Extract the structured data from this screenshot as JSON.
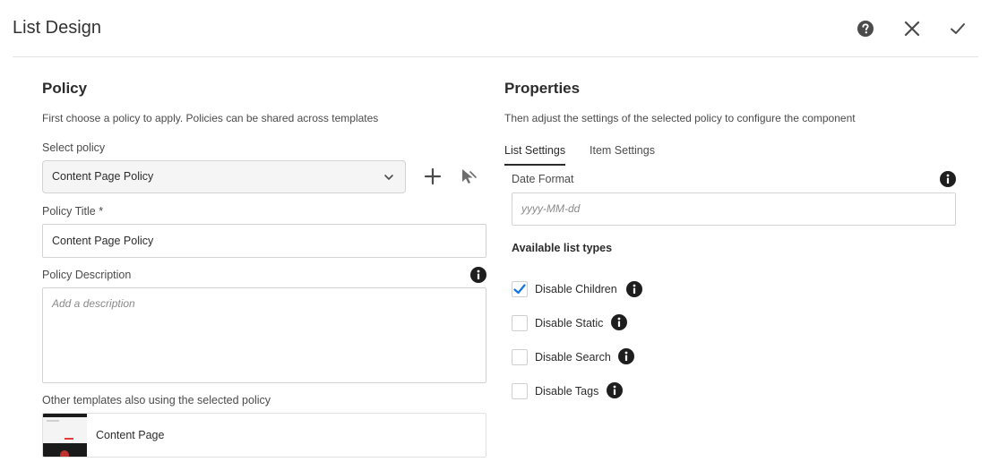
{
  "header": {
    "title": "List Design",
    "help_icon": "help-circle-icon",
    "close_icon": "close-icon",
    "done_icon": "checkmark-icon"
  },
  "policy": {
    "title": "Policy",
    "description": "First choose a policy to apply. Policies can be shared across templates",
    "select_label": "Select policy",
    "selected_policy": "Content Page Policy",
    "add_icon": "add-icon",
    "select_icon": "select-cursor-icon",
    "title_label": "Policy Title *",
    "title_value": "Content Page Policy",
    "description_label": "Policy Description",
    "description_placeholder": "Add a description",
    "other_templates_label": "Other templates also using the selected policy",
    "templates": [
      {
        "name": "Content Page"
      }
    ]
  },
  "properties": {
    "title": "Properties",
    "description": "Then adjust the settings of the selected policy to configure the component",
    "tabs": [
      {
        "label": "List Settings",
        "active": true
      },
      {
        "label": "Item Settings",
        "active": false
      }
    ],
    "date_format_label": "Date Format",
    "date_format_placeholder": "yyyy-MM-dd",
    "list_types_heading": "Available list types",
    "list_types": [
      {
        "label": "Disable Children",
        "checked": true
      },
      {
        "label": "Disable Static",
        "checked": false
      },
      {
        "label": "Disable Search",
        "checked": false
      },
      {
        "label": "Disable Tags",
        "checked": false
      }
    ]
  },
  "colors": {
    "accent": "#1473e6",
    "icon": "#323232",
    "border": "#d3d3d3"
  }
}
